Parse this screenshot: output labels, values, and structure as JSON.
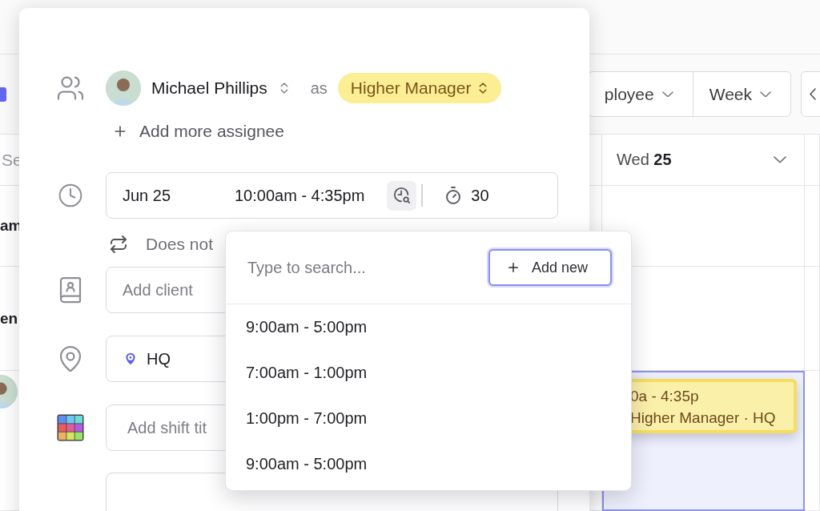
{
  "background": {
    "toolbar": {
      "group_filter": "ployee",
      "range": "Week"
    },
    "search": {
      "placeholder": "Se"
    },
    "day_header": {
      "day": "Wed",
      "date": "25"
    },
    "row_labels": [
      "am",
      "en"
    ],
    "shift": {
      "time": "0a - 4:35p",
      "detail": "Higher Manager · HQ",
      "selected": true
    }
  },
  "modal": {
    "assignee": {
      "name": "Michael Phillips",
      "connector": "as",
      "role": "Higher Manager"
    },
    "add_assignee": "Add more assignee",
    "time": {
      "date": "Jun 25",
      "range": "10:00am - 4:35pm",
      "break": "30"
    },
    "repeat": "Does not",
    "client": {
      "placeholder": "Add client"
    },
    "location": {
      "value": "HQ"
    },
    "shift_title": {
      "placeholder": "Add shift tit"
    }
  },
  "dropdown": {
    "search": {
      "placeholder": "Type to search..."
    },
    "add_button": "Add new",
    "options": [
      "9:00am - 5:00pm",
      "7:00am - 1:00pm",
      "1:00pm - 7:00pm",
      "9:00am - 5:00pm"
    ]
  }
}
